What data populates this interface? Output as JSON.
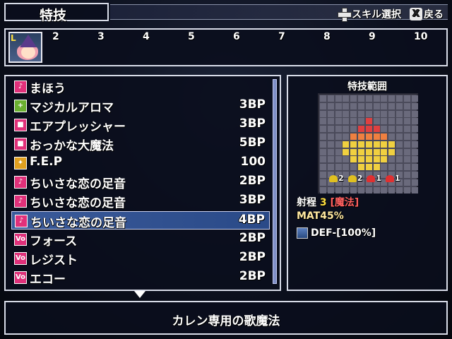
{
  "title": "特技",
  "hints": [
    {
      "icon": "dpad-icon",
      "label": "スキル選択"
    },
    {
      "icon": "x-button-icon",
      "glyph": "X",
      "label": "戻る"
    }
  ],
  "level_bar": {
    "portrait_label": "L",
    "levels": [
      "2",
      "3",
      "4",
      "5",
      "6",
      "7",
      "8",
      "9",
      "10"
    ]
  },
  "skills": [
    {
      "name": "まほう",
      "cost": "",
      "icon_color": "#e0307a",
      "glyph": "♪"
    },
    {
      "name": "マジカルアロマ",
      "cost": "3BP",
      "icon_color": "#6ab030",
      "glyph": "+"
    },
    {
      "name": "エアプレッシャー",
      "cost": "3BP",
      "icon_color": "#e0307a",
      "glyph": "■"
    },
    {
      "name": "おっかな大魔法",
      "cost": "5BP",
      "icon_color": "#e0307a",
      "glyph": "■"
    },
    {
      "name": "F.E.P",
      "cost": "100",
      "icon_color": "#e0a020",
      "glyph": "✦"
    },
    {
      "name": "ちいさな恋の足音",
      "cost": "2BP",
      "icon_color": "#e0307a",
      "glyph": "♪"
    },
    {
      "name": "ちいさな恋の足音",
      "cost": "3BP",
      "icon_color": "#e0307a",
      "glyph": "♪"
    },
    {
      "name": "ちいさな恋の足音",
      "cost": "4BP",
      "icon_color": "#e0307a",
      "glyph": "♪",
      "selected": true
    },
    {
      "name": "フォース",
      "cost": "2BP",
      "icon_color": "#e0307a",
      "glyph": "Vo"
    },
    {
      "name": "レジスト",
      "cost": "2BP",
      "icon_color": "#e0307a",
      "glyph": "Vo"
    },
    {
      "name": "エコー",
      "cost": "2BP",
      "icon_color": "#e0307a",
      "glyph": "Vo"
    }
  ],
  "range_panel": {
    "title": "特技範囲",
    "pips": [
      {
        "value": "2",
        "color": "#e0c020"
      },
      {
        "value": "2",
        "color": "#e0c020"
      },
      {
        "value": "1",
        "color": "#e03030"
      },
      {
        "value": "1",
        "color": "#e03030"
      }
    ],
    "range_label": "射程",
    "range_value": "3",
    "range_type": "[魔法]",
    "mat": "MAT45%",
    "def": "DEF-[100%]"
  },
  "description": "カレン専用の歌魔法"
}
